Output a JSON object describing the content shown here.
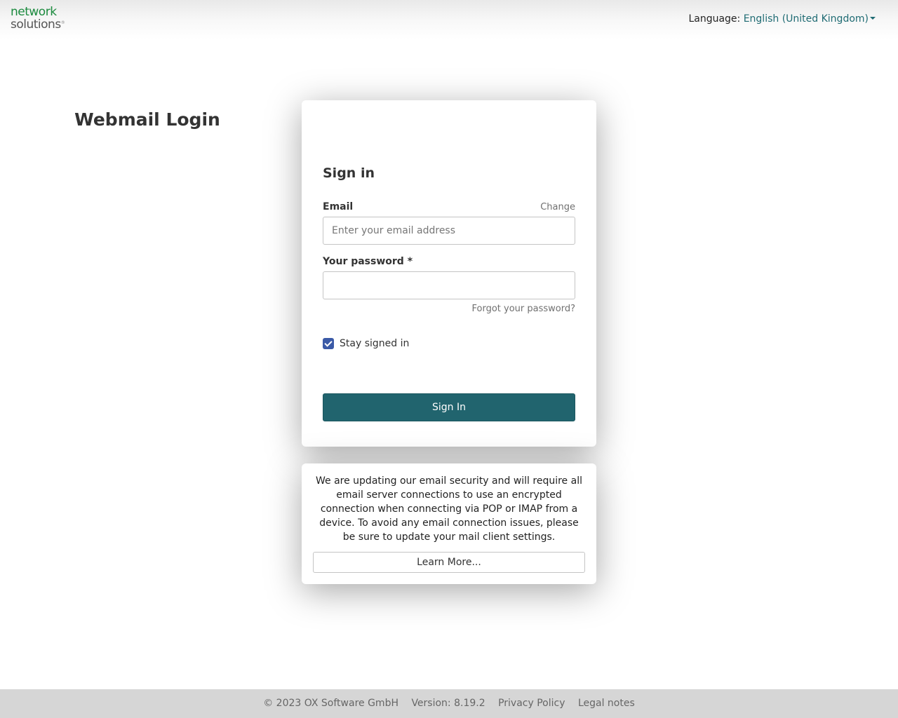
{
  "header": {
    "logo_line1": "network",
    "logo_line2": "solutions",
    "logo_mark": "®",
    "language_label": "Language:",
    "language_value": "English (United Kingdom)"
  },
  "login": {
    "title": "Webmail Login",
    "heading": "Sign in",
    "email_label": "Email",
    "change_link": "Change",
    "email_placeholder": "Enter your email address",
    "email_value": "",
    "password_label": "Your password *",
    "password_value": "",
    "forgot_link": "Forgot your password?",
    "stay_signed_in_label": "Stay signed in",
    "stay_signed_in_checked": true,
    "sign_in_button": "Sign In"
  },
  "notice": {
    "text": "We are updating our email security and will require all email server connections to use an encrypted connection when connecting via POP or IMAP from a device. To avoid any email connection issues, please be sure to update your mail client settings.",
    "learn_more_button": "Learn More..."
  },
  "footer": {
    "copyright": "© 2023 OX Software GmbH",
    "version": "Version: 8.19.2",
    "privacy": "Privacy Policy",
    "legal": "Legal notes"
  },
  "colors": {
    "accent": "#21646e",
    "logo_green": "#1b8a3e",
    "checkbox": "#3b5aa7"
  }
}
